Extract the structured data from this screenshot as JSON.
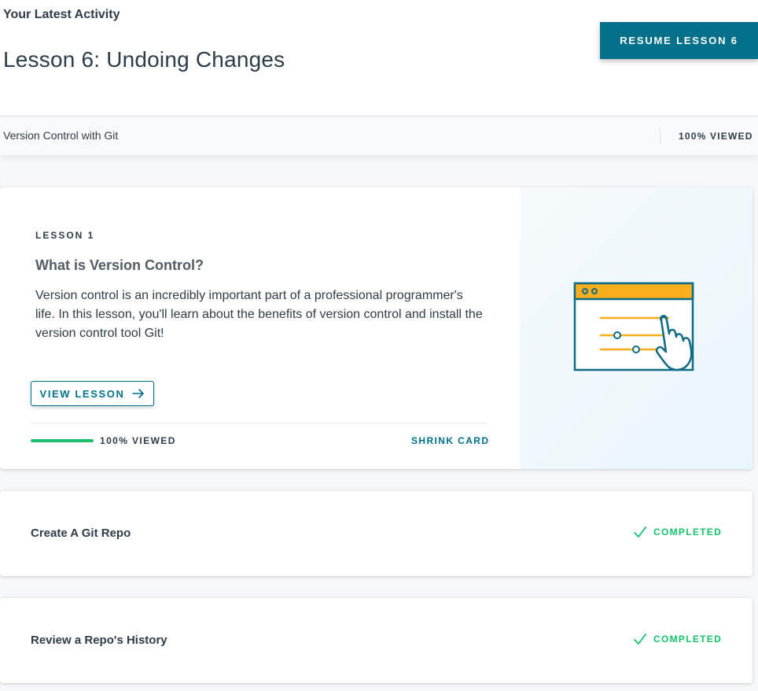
{
  "header": {
    "section_label": "Your Latest Activity",
    "lesson_heading": "Lesson 6: Undoing Changes",
    "resume_button": "RESUME LESSON 6"
  },
  "course": {
    "name": "Version Control with Git",
    "progress_label": "100% VIEWED"
  },
  "active_lesson": {
    "eyebrow": "LESSON 1",
    "title": "What is Version Control?",
    "description": "Version control is an incredibly important part of a professional programmer's life. In this lesson, you'll learn about the benefits of version control and install the version control tool Git!",
    "view_button": "VIEW LESSON",
    "progress_fraction": 1.0,
    "progress_label": "100% VIEWED",
    "shrink_label": "SHRINK CARD",
    "illustration_icon": "browser-sliders-hand-icon"
  },
  "lessons": [
    {
      "title": "Create A Git Repo",
      "status": "COMPLETED",
      "status_icon": "check-icon"
    },
    {
      "title": "Review a Repo's History",
      "status": "COMPLETED",
      "status_icon": "check-icon"
    }
  ],
  "colors": {
    "accent": "#02708a",
    "success": "#1ec070",
    "illustration_orange": "#f9ae1b"
  }
}
